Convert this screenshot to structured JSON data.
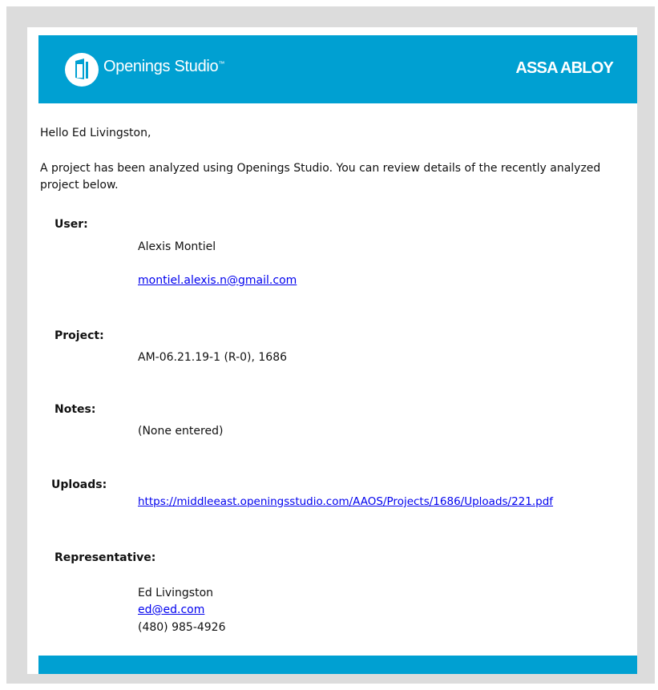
{
  "header": {
    "product_name": "Openings Studio",
    "trademark": "™",
    "brand": "ASSA ABLOY",
    "logo_icon": "door-icon",
    "banner_color": "#00a0d2"
  },
  "greeting": "Hello Ed Livingston,",
  "intro": "A project has been analyzed using Openings Studio. You can review details of the recently analyzed project below.",
  "user": {
    "label": "User:",
    "name": "Alexis Montiel",
    "email": "montiel.alexis.n@gmail.com"
  },
  "project": {
    "label": "Project:",
    "value": "AM-06.21.19-1 (R-0), 1686"
  },
  "notes": {
    "label": "Notes:",
    "value": "(None entered)"
  },
  "uploads": {
    "label": "Uploads:",
    "link": "https://middleeast.openingsstudio.com/AAOS/Projects/1686/Uploads/221.pdf"
  },
  "representative": {
    "label": "Representative:",
    "name": "Ed Livingston",
    "email": "ed@ed.com",
    "phone": "(480) 985-4926"
  }
}
